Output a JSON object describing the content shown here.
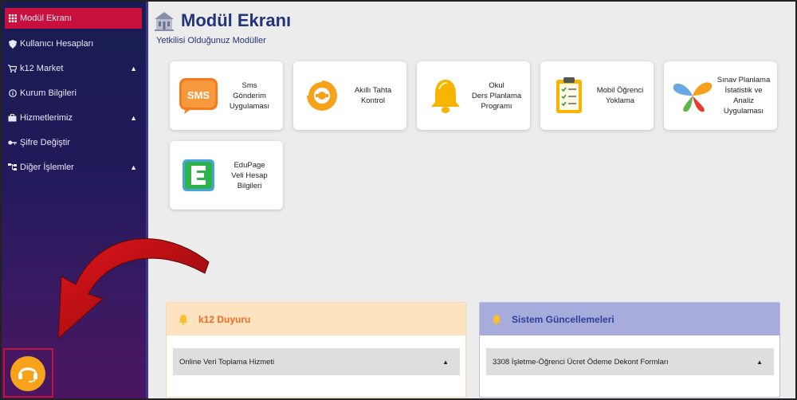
{
  "sidebar": {
    "items": [
      {
        "label": "Modül Ekranı",
        "icon": "grid-icon",
        "active": true,
        "expandable": false
      },
      {
        "label": "Kullanıcı Hesapları",
        "icon": "shield-icon",
        "active": false,
        "expandable": false
      },
      {
        "label": "k12 Market",
        "icon": "cart-icon",
        "active": false,
        "expandable": true
      },
      {
        "label": "Kurum Bilgileri",
        "icon": "info-icon",
        "active": false,
        "expandable": false
      },
      {
        "label": "Hizmetlerimiz",
        "icon": "briefcase-icon",
        "active": false,
        "expandable": true
      },
      {
        "label": "Şifre Değiştir",
        "icon": "key-icon",
        "active": false,
        "expandable": false
      },
      {
        "label": "Diğer İşlemler",
        "icon": "sitemap-icon",
        "active": false,
        "expandable": true
      }
    ]
  },
  "header": {
    "title": "Modül Ekranı",
    "subtitle": "Yetkilisi Olduğunuz Modüller"
  },
  "modules": [
    {
      "label": "Sms\nGönderim\nUygulaması",
      "icon": "sms-icon"
    },
    {
      "label": "Akıllı Tahta\nKontrol",
      "icon": "smartboard-icon"
    },
    {
      "label": "Okul\nDers Planlama\nProgramı",
      "icon": "bell-icon"
    },
    {
      "label": "Mobil Öğrenci\nYoklama",
      "icon": "clipboard-icon"
    },
    {
      "label": "Sınav Planlama\nİstatistik ve\nAnaliz\nUygulaması",
      "icon": "butterfly-icon"
    },
    {
      "label": "EduPage\nVeli Hesap\nBilgileri",
      "icon": "edupage-icon"
    }
  ],
  "panels": {
    "announcement": {
      "title": "k12 Duyuru",
      "item": "Online Veri Toplama Hizmeti",
      "color": "#f26b22"
    },
    "updates": {
      "title": "Sistem Güncellemeleri",
      "item": "3308 İşletme-Öğrenci Ücret Ödeme Dekont Formları",
      "color": "#2e3f9a"
    }
  },
  "colors": {
    "active_item": "#c8103e",
    "accent_orange": "#f7a21b",
    "title_blue": "#23357a"
  }
}
